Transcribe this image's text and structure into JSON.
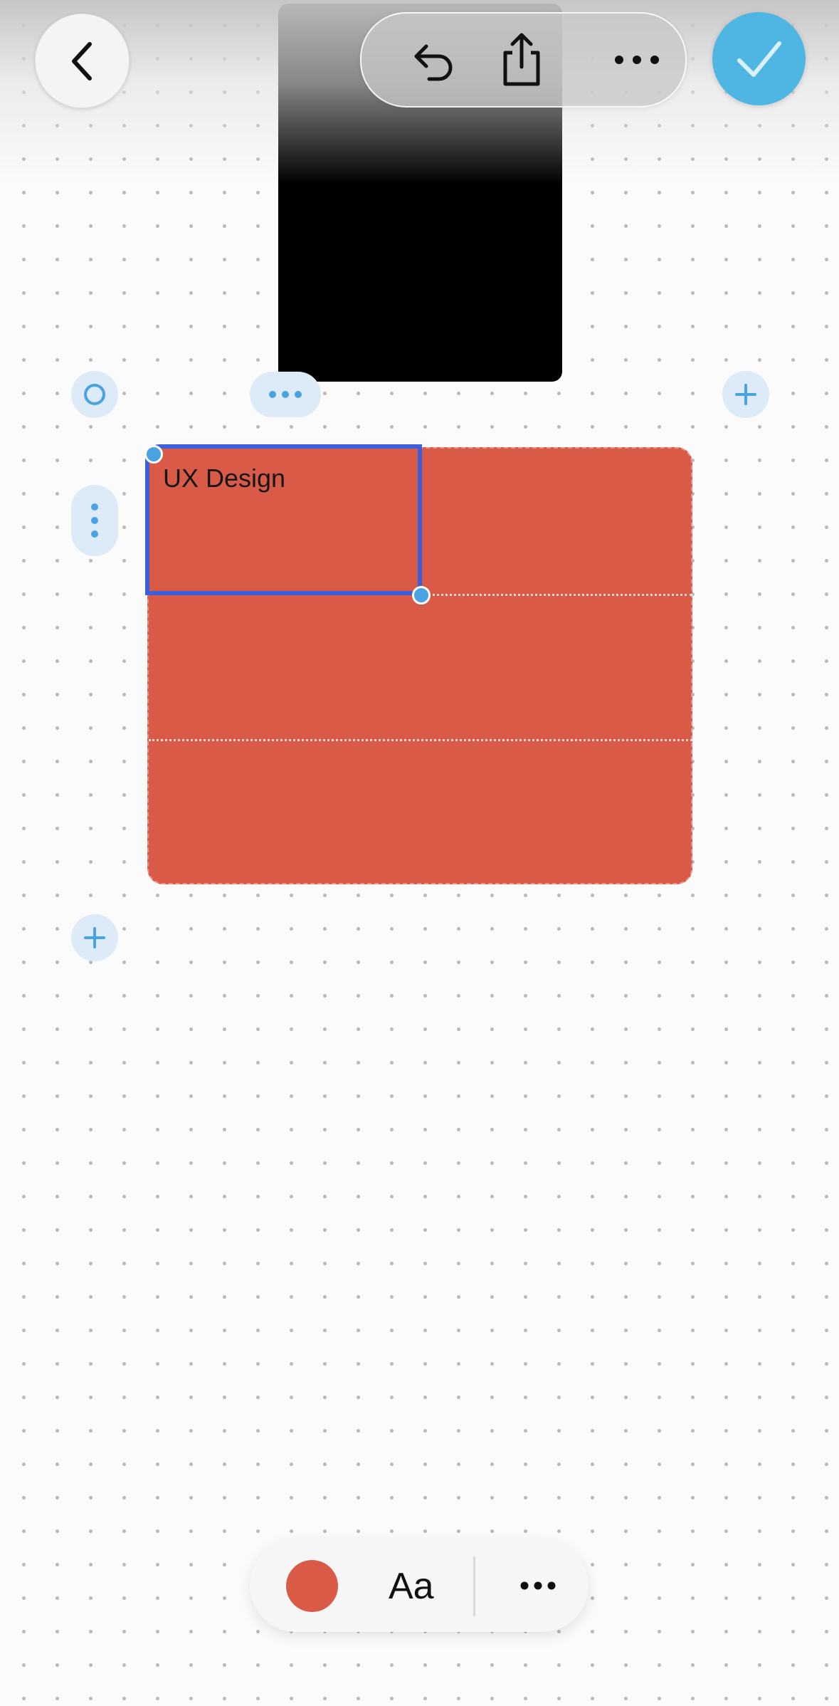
{
  "header": {
    "back_icon": "chevron-left-icon",
    "toolbar": [
      {
        "name": "undo",
        "icon": "undo-icon"
      },
      {
        "name": "share",
        "icon": "share-icon"
      },
      {
        "name": "more",
        "icon": "more-horizontal-icon"
      }
    ],
    "done_icon": "checkmark-icon",
    "done_color": "#4fb6e3"
  },
  "table": {
    "fill_color": "#d95b47",
    "selection_color": "#3a5fdc",
    "rows": 3,
    "cells": [
      {
        "row": 1,
        "col": 1,
        "text": "UX Design",
        "selected": true
      }
    ]
  },
  "table_handles": {
    "top_left": "circle-icon",
    "column_menu": "more-horizontal-icon",
    "add_column": "plus-icon",
    "row_menu": "more-vertical-icon",
    "add_row": "plus-icon"
  },
  "bottom_toolbar": {
    "color_swatch": "#d95b47",
    "text_style_label": "Aa",
    "more_icon": "more-horizontal-icon"
  }
}
